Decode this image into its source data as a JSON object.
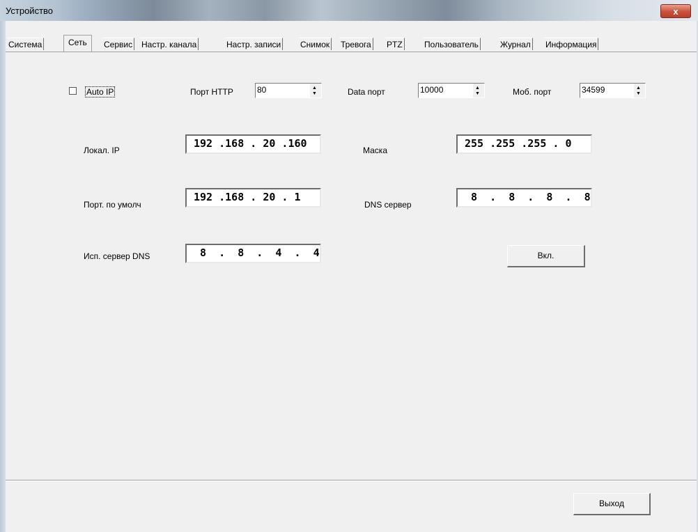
{
  "window": {
    "title": "Устройство",
    "close_glyph": "x"
  },
  "tabs": [
    {
      "label": "Система"
    },
    {
      "label": "Сеть"
    },
    {
      "label": "Сервис"
    },
    {
      "label": "Настр. канала"
    },
    {
      "label": "Настр. записи"
    },
    {
      "label": "Снимок"
    },
    {
      "label": "Тревога"
    },
    {
      "label": "PTZ"
    },
    {
      "label": "Пользователь"
    },
    {
      "label": "Журнал"
    },
    {
      "label": "Информация"
    }
  ],
  "network": {
    "auto_ip": {
      "label": "Auto IP",
      "checked": false
    },
    "http_port": {
      "label": "Порт HTTP",
      "value": "80"
    },
    "data_port": {
      "label": "Data порт",
      "value": "10000"
    },
    "mobile_port": {
      "label": "Моб. порт",
      "value": "34599"
    },
    "local_ip": {
      "label": "Локал. IP",
      "value": "192 .168 . 20 .160"
    },
    "mask": {
      "label": "Маска",
      "value": "255 .255 .255 . 0"
    },
    "gateway": {
      "label": "Порт. по умолч",
      "value": "192 .168 . 20 . 1"
    },
    "dns": {
      "label": "DNS сервер",
      "value": " 8  .  8  .  8  .  8"
    },
    "alt_dns": {
      "label": "Исп. сервер DNS",
      "value": " 8  .  8  .  4  .  4"
    },
    "enable_button": "Вкл."
  },
  "footer": {
    "exit_button": "Выход"
  }
}
